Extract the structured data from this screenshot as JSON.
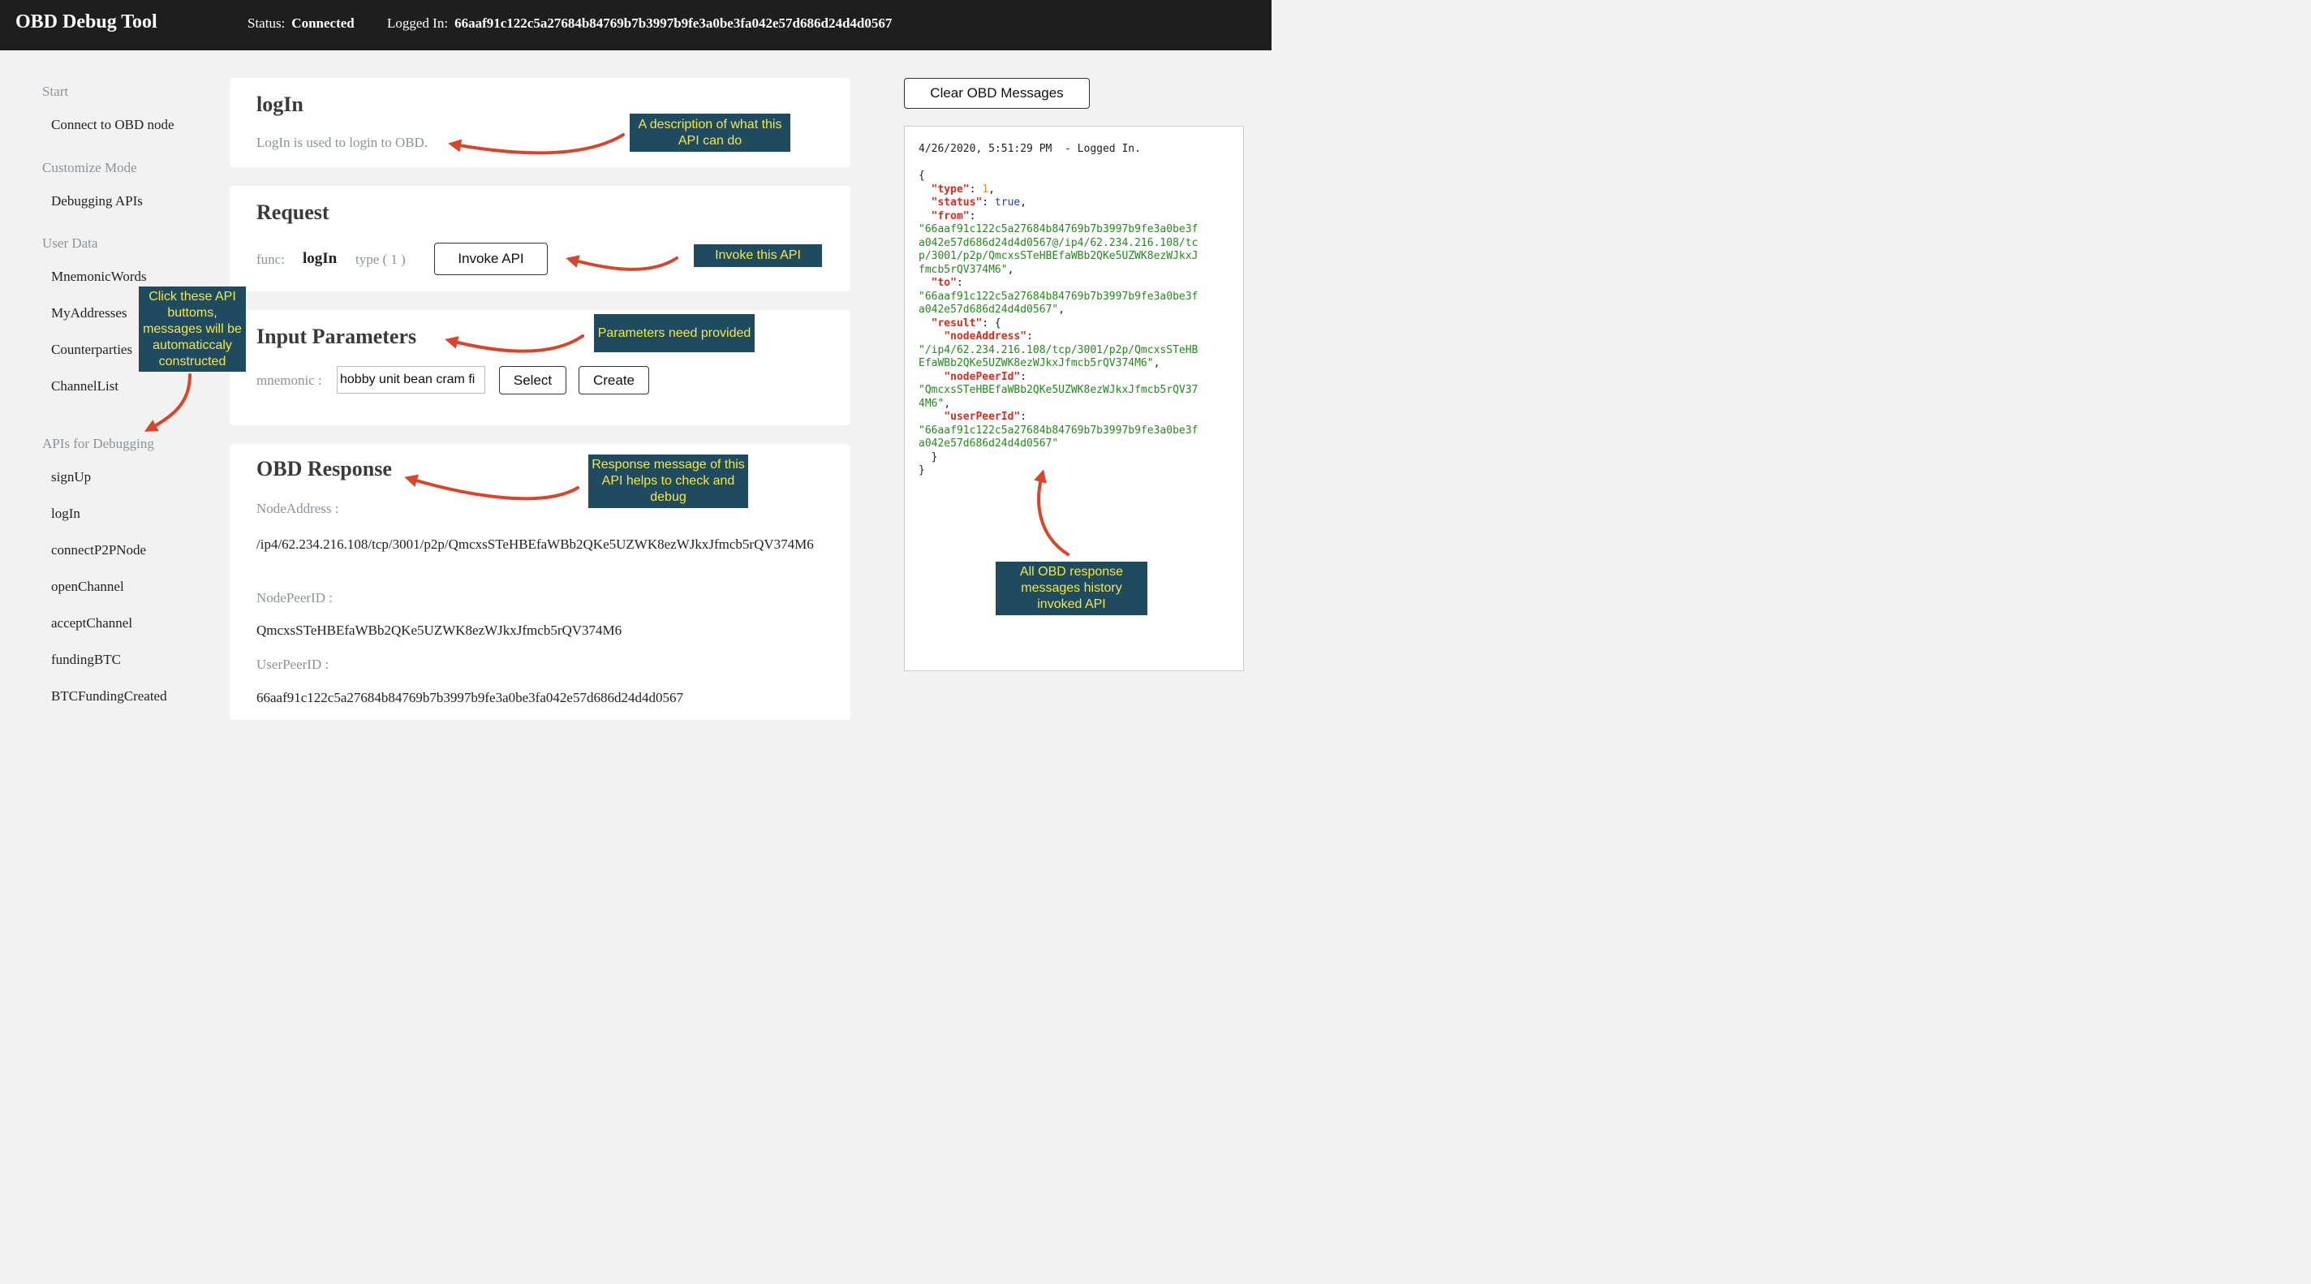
{
  "header": {
    "app_title": "OBD Debug Tool",
    "status_label": "Status:",
    "status_value": "Connected",
    "login_label": "Logged In:",
    "login_value": "66aaf91c122c5a27684b84769b7b3997b9fe3a0be3fa042e57d686d24d4d0567"
  },
  "sidebar": {
    "start": {
      "title": "Start",
      "items": [
        "Connect to OBD node"
      ]
    },
    "customize": {
      "title": "Customize Mode",
      "items": [
        "Debugging APIs"
      ]
    },
    "user_data": {
      "title": "User Data",
      "items": [
        "MnemonicWords",
        "MyAddresses",
        "Counterparties",
        "ChannelList"
      ]
    },
    "apis": {
      "title": "APIs for Debugging",
      "items": [
        "signUp",
        "logIn",
        "connectP2PNode",
        "openChannel",
        "acceptChannel",
        "fundingBTC",
        "BTCFundingCreated"
      ]
    }
  },
  "api_card": {
    "title": "logIn",
    "description": "LogIn is used to login to OBD."
  },
  "request": {
    "title": "Request",
    "func_label": "func:",
    "func_value": "logIn",
    "type_label": "type ( 1 )",
    "invoke_button": "Invoke API"
  },
  "params": {
    "title": "Input Parameters",
    "mnemonic_label": "mnemonic :",
    "mnemonic_value": "hobby unit bean cram fi",
    "select_button": "Select",
    "create_button": "Create"
  },
  "response": {
    "title": "OBD Response",
    "node_address_label": "NodeAddress :",
    "node_address_value": "/ip4/62.234.216.108/tcp/3001/p2p/QmcxsSTeHBEfaWBb2QKe5UZWK8ezWJkxJfmcb5rQV374M6",
    "node_peer_label": "NodePeerID :",
    "node_peer_value": "QmcxsSTeHBEfaWBb2QKe5UZWK8ezWJkxJfmcb5rQV374M6",
    "user_peer_label": "UserPeerID :",
    "user_peer_value": "66aaf91c122c5a27684b84769b7b3997b9fe3a0be3fa042e57d686d24d4d0567"
  },
  "clear_button": "Clear OBD Messages",
  "log": {
    "header": "4/26/2020, 5:51:29 PM  - Logged In.",
    "open_brace": "{",
    "type_key": "\"type\"",
    "type_value": "1",
    "status_key": "\"status\"",
    "status_value": "true",
    "from_key": "\"from\"",
    "from_value": "\"66aaf91c122c5a27684b84769b7b3997b9fe3a0be3f\na042e57d686d24d4d0567@/ip4/62.234.216.108/tc\np/3001/p2p/QmcxsSTeHBEfaWBb2QKe5UZWK8ezWJkxJ\nfmcb5rQV374M6\"",
    "to_key": "\"to\"",
    "to_value": "\"66aaf91c122c5a27684b84769b7b3997b9fe3a0be3f\na042e57d686d24d4d0567\"",
    "result_key": "\"result\"",
    "node_address_key": "\"nodeAddress\"",
    "node_address_value": "\"/ip4/62.234.216.108/tcp/3001/p2p/QmcxsSTeHB\nEfaWBb2QKe5UZWK8ezWJkxJfmcb5rQV374M6\"",
    "node_peer_key": "\"nodePeerId\"",
    "node_peer_value": "\"QmcxsSTeHBEfaWBb2QKe5UZWK8ezWJkxJfmcb5rQV37\n4M6\"",
    "user_peer_key": "\"userPeerId\"",
    "user_peer_value": "\"66aaf91c122c5a27684b84769b7b3997b9fe3a0be3f\na042e57d686d24d4d0567\"",
    "close_inner": "}",
    "close_outer": "}"
  },
  "annotations": {
    "description": "A description of what this API can do",
    "invoke": "Invoke this API",
    "params": "Parameters need provided",
    "buttons": "Click these API buttoms, messages will be automaticcaly constructed",
    "response": "Response message of this API helps to check and debug",
    "history": "All OBD response messages history invoked API"
  },
  "colors": {
    "header_bg": "#1e1e1e",
    "annotation_bg": "#1f4b60",
    "annotation_text": "#f4e64a",
    "arrow": "#d9452b",
    "json_key": "#d62d20",
    "json_string": "#258a1e"
  }
}
